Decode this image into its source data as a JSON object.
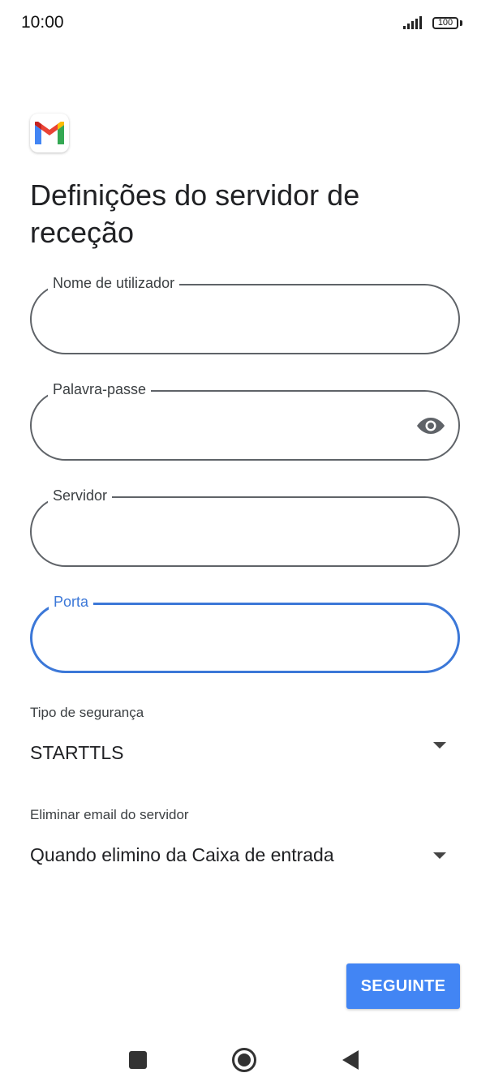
{
  "status_bar": {
    "time": "10:00",
    "battery": "100"
  },
  "app": {
    "logo": "gmail-logo"
  },
  "page": {
    "title": "Definições do servidor de receção"
  },
  "fields": {
    "username": {
      "label": "Nome de utilizador",
      "value": ""
    },
    "password": {
      "label": "Palavra-passe",
      "value": "",
      "icon": "eye-icon"
    },
    "server": {
      "label": "Servidor",
      "value": ""
    },
    "port": {
      "label": "Porta",
      "value": "",
      "focused": true
    }
  },
  "security": {
    "label": "Tipo de segurança",
    "value": "STARTTLS"
  },
  "delete_email": {
    "label": "Eliminar email do servidor",
    "value": "Quando elimino da Caixa de entrada"
  },
  "actions": {
    "next_label": "SEGUINTE"
  },
  "colors": {
    "accent": "#4285f4",
    "focus": "#3c78d8",
    "outline": "#5f6368"
  },
  "nav": {
    "icons": [
      "recents-square-icon",
      "home-circle-icon",
      "back-triangle-icon"
    ]
  }
}
